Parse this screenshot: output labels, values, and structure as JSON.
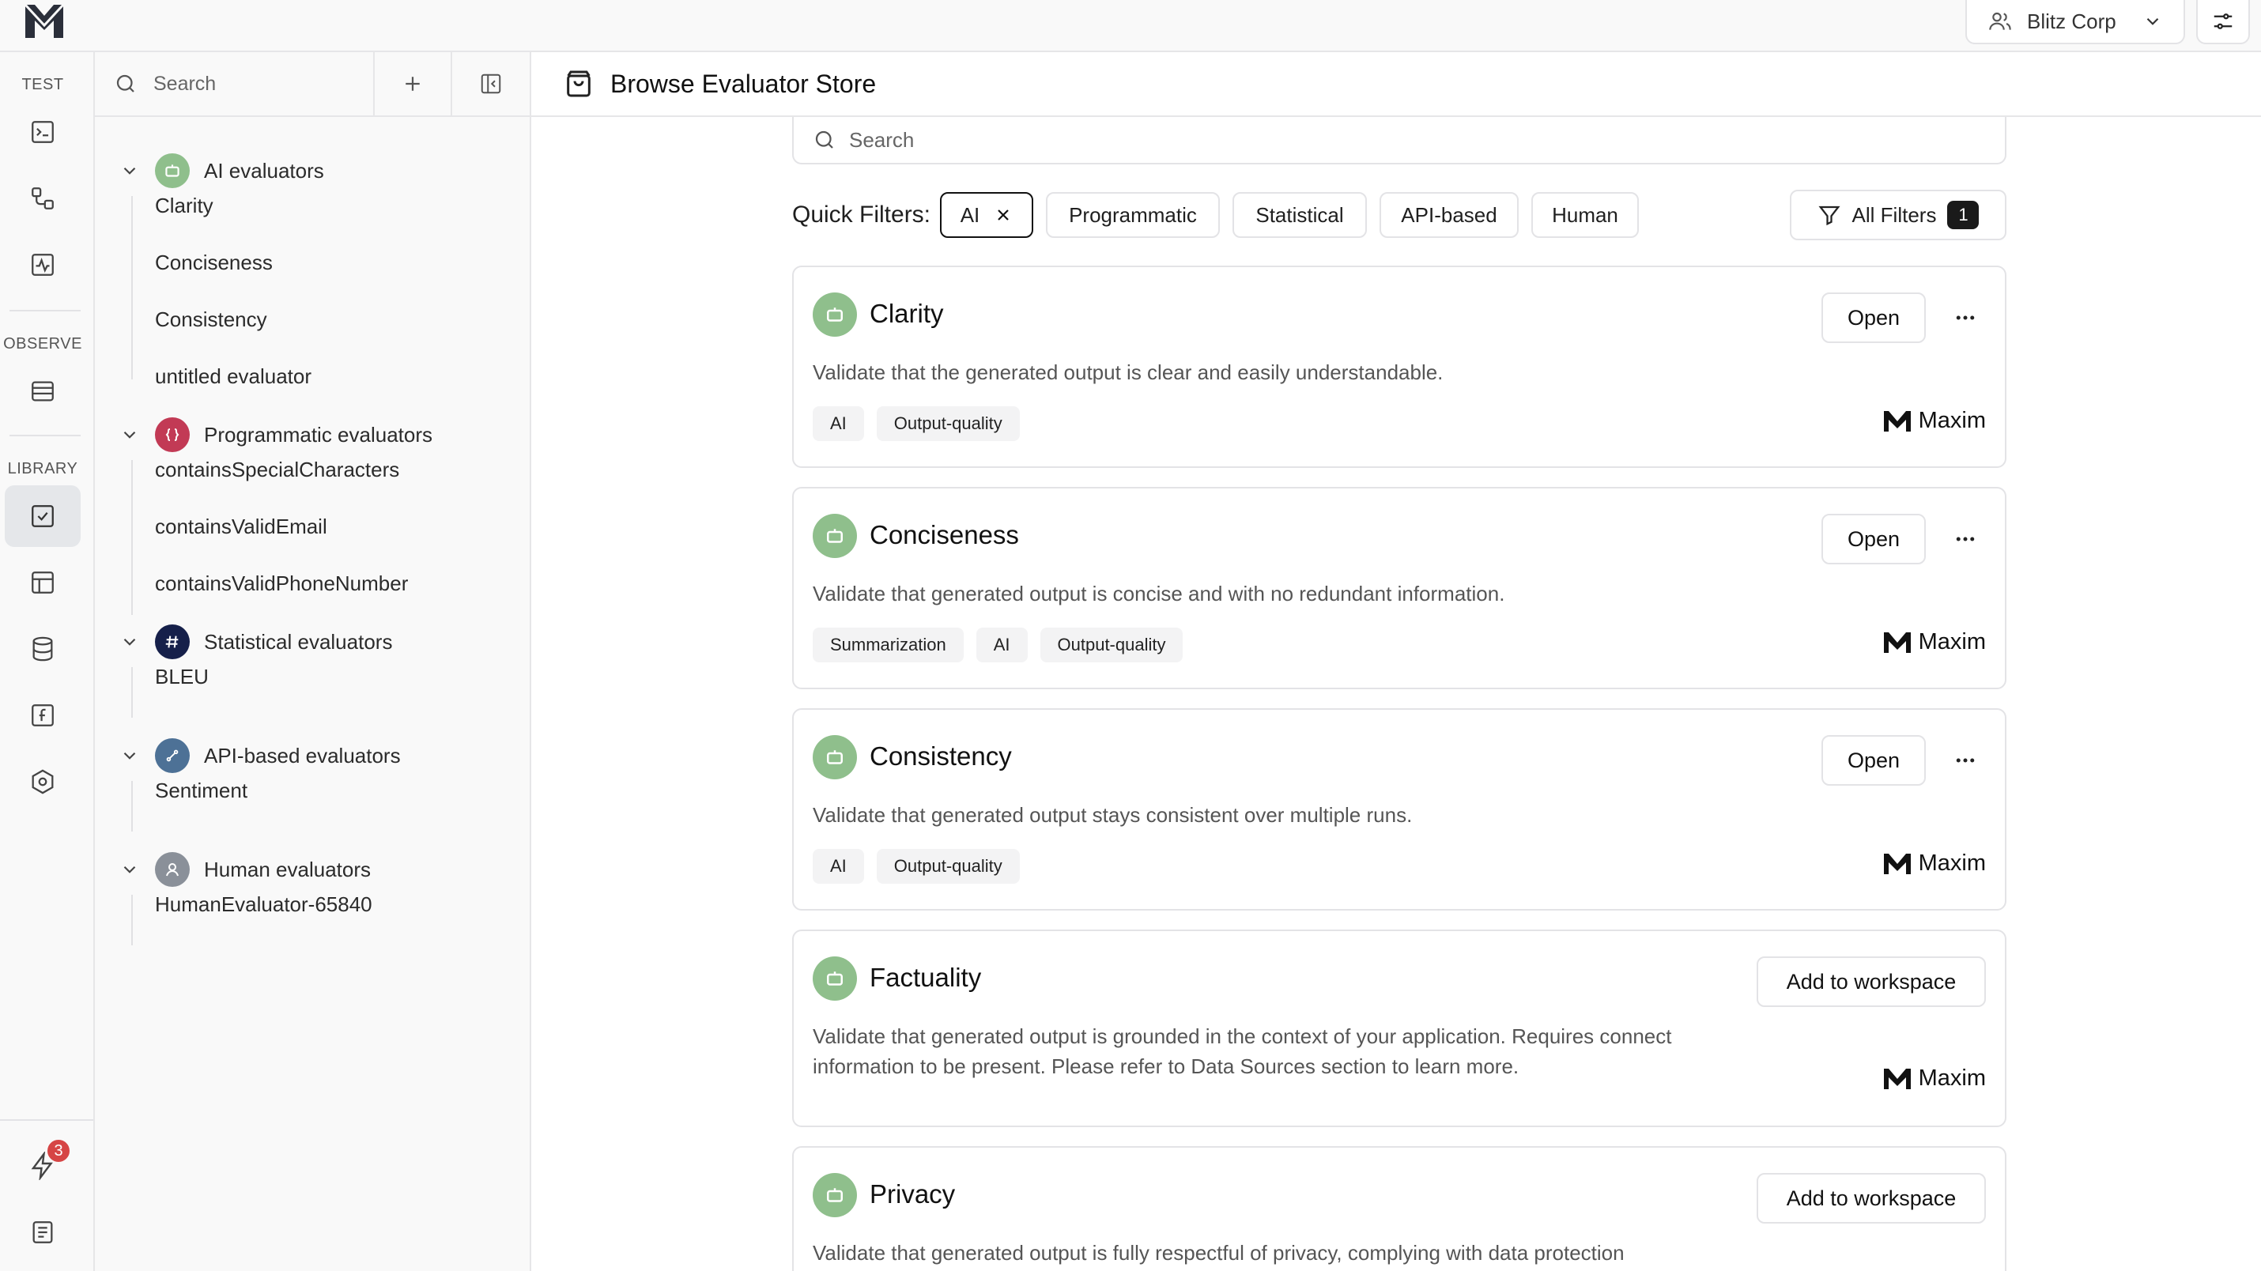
{
  "org": {
    "name": "Blitz Corp"
  },
  "rail": {
    "sections": {
      "test": "TEST",
      "observe": "OBSERVE",
      "library": "LIBRARY"
    },
    "notification_count": "3"
  },
  "sidebar": {
    "search_placeholder": "Search",
    "groups": [
      {
        "label": "AI evaluators",
        "color": "#8fbf8c",
        "items": [
          "Clarity",
          "Conciseness",
          "Consistency",
          "untitled evaluator"
        ]
      },
      {
        "label": "Programmatic evaluators",
        "color": "#c23a55",
        "items": [
          "containsSpecialCharacters",
          "containsValidEmail",
          "containsValidPhoneNumber"
        ]
      },
      {
        "label": "Statistical evaluators",
        "color": "#16204a",
        "items": [
          "BLEU"
        ]
      },
      {
        "label": "API-based evaluators",
        "color": "#4d7196",
        "items": [
          "Sentiment"
        ]
      },
      {
        "label": "Human evaluators",
        "color": "#8a9099",
        "items": [
          "HumanEvaluator-65840"
        ]
      }
    ]
  },
  "main": {
    "title": "Browse Evaluator Store",
    "search_placeholder": "Search",
    "quick_filters_label": "Quick Filters:",
    "filters": [
      "AI",
      "Programmatic",
      "Statistical",
      "API-based",
      "Human"
    ],
    "active_filter": "AI",
    "all_filters_label": "All Filters",
    "all_filters_count": "1",
    "cards": [
      {
        "title": "Clarity",
        "description": "Validate that the generated output is clear and easily understandable.",
        "action": "Open",
        "tags": [
          "AI",
          "Output-quality"
        ],
        "maker": "Maxim"
      },
      {
        "title": "Conciseness",
        "description": "Validate that generated output is concise and with no redundant information.",
        "action": "Open",
        "tags": [
          "Summarization",
          "AI",
          "Output-quality"
        ],
        "maker": "Maxim"
      },
      {
        "title": "Consistency",
        "description": "Validate that generated output stays consistent over multiple runs.",
        "action": "Open",
        "tags": [
          "AI",
          "Output-quality"
        ],
        "maker": "Maxim"
      },
      {
        "title": "Factuality",
        "description": "Validate that generated output is grounded in the context of your application. Requires connect information to be present. Please refer to Data Sources section to learn more.",
        "action": "Add to workspace",
        "tags": [],
        "maker": "Maxim"
      },
      {
        "title": "Privacy",
        "description": "Validate that generated output is fully respectful of privacy, complying with data protection",
        "action": "Add to workspace",
        "tags": [],
        "maker": "Maxim"
      }
    ]
  }
}
